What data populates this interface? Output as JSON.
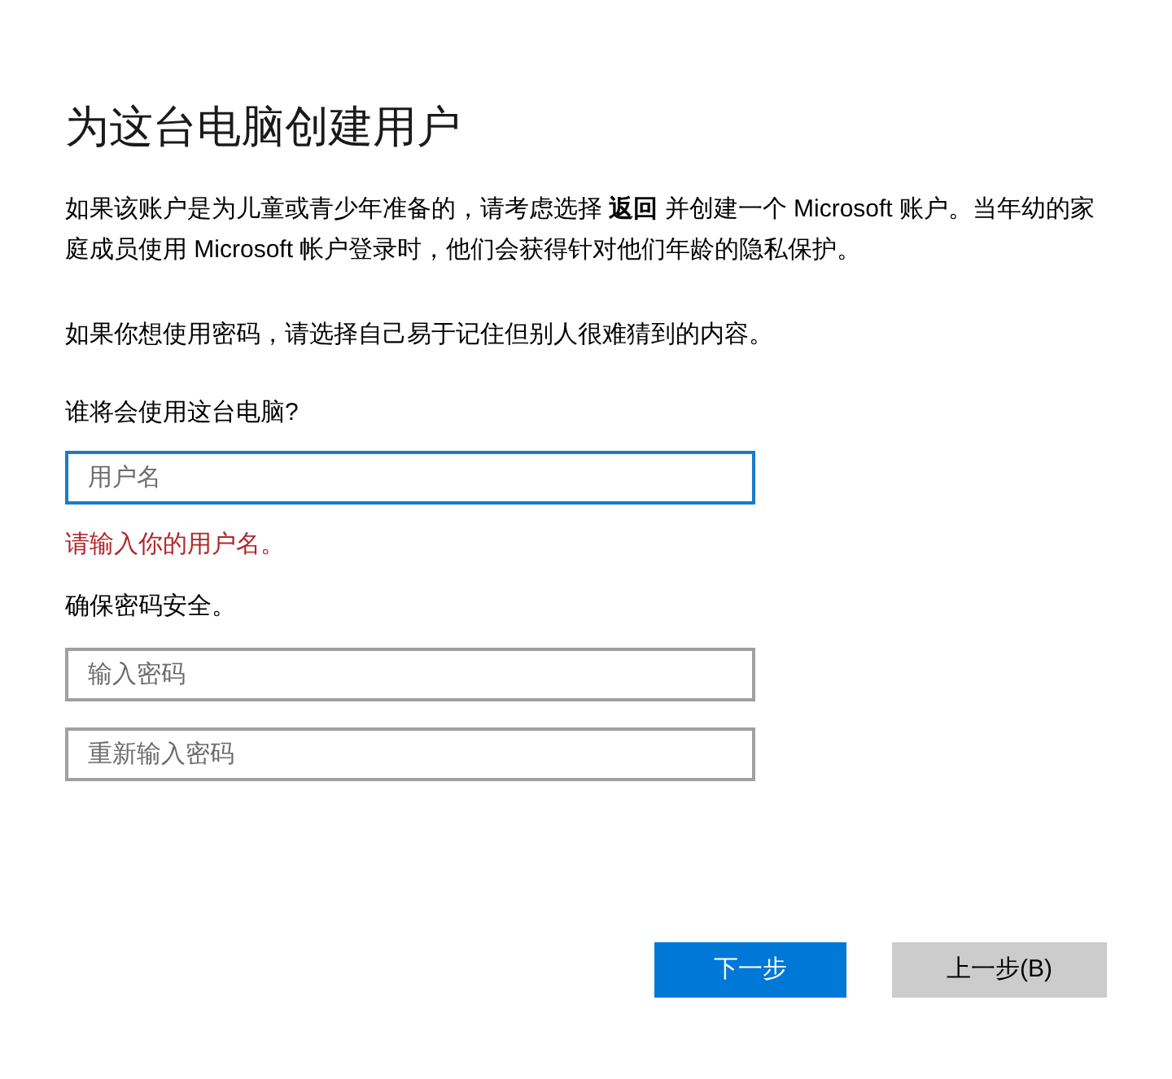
{
  "title": "为这台电脑创建用户",
  "paragraphs": [
    "如果该账户是为儿童或青少年准备的，请考虑选择 **返回** 并创建一个 Microsoft 账户。当年幼的家庭成员使用 Microsoft 帐户登录时，他们会获得针对他们年龄的隐私保护。",
    "如果你想使用密码，请选择自己易于记住但别人很难猜到的内容。"
  ],
  "user_section": {
    "label": "谁将会使用这台电脑?",
    "field": {
      "placeholder": "用户名",
      "focused": true
    },
    "error": "请输入你的用户名。"
  },
  "password_section": {
    "label": "确保密码安全。",
    "fields": [
      {
        "placeholder": "输入密码",
        "focused": false
      },
      {
        "placeholder": "重新输入密码",
        "focused": false
      }
    ]
  },
  "buttons": [
    {
      "label": "下一步",
      "kind": "primary"
    },
    {
      "label": "上一步(B)",
      "kind": "secondary"
    }
  ]
}
